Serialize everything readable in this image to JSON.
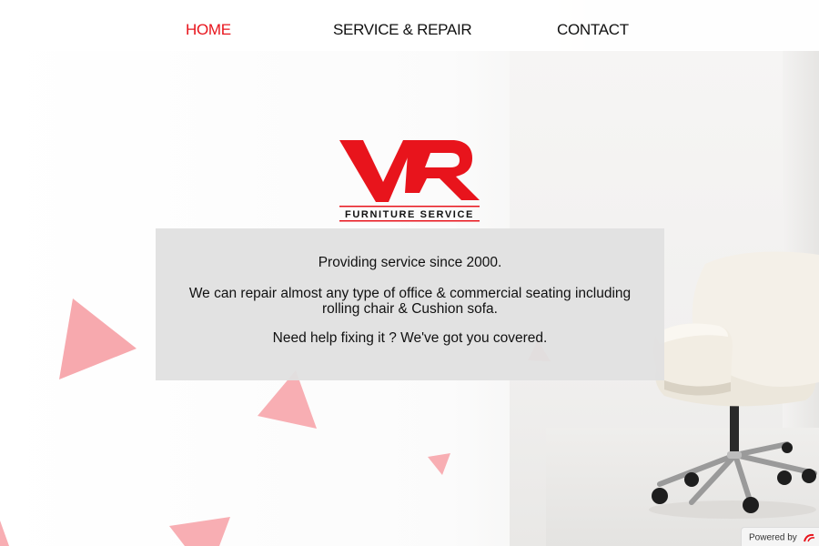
{
  "nav": {
    "items": [
      {
        "label": "HOME",
        "active": true
      },
      {
        "label": "SERVICE & REPAIR",
        "active": false
      },
      {
        "label": "CONTACT",
        "active": false
      }
    ]
  },
  "logo": {
    "initials": "VR",
    "tagline": "FURNITURE SERVICE"
  },
  "content": {
    "line1": "Providing service since 2000.",
    "line2": "We can repair almost any type of office & commercial seating including rolling chair & Cushion sofa.",
    "line3": "Need help fixing it ? We've got you covered."
  },
  "footer": {
    "powered_label": "Powered by",
    "powered_brand": "O"
  },
  "colors": {
    "accent": "#e8141c",
    "triangle": "#f8b1b6",
    "box": "#e0e0e0"
  },
  "icons": {
    "logo": "vr-logo-icon",
    "powered": "provider-logo-icon"
  }
}
